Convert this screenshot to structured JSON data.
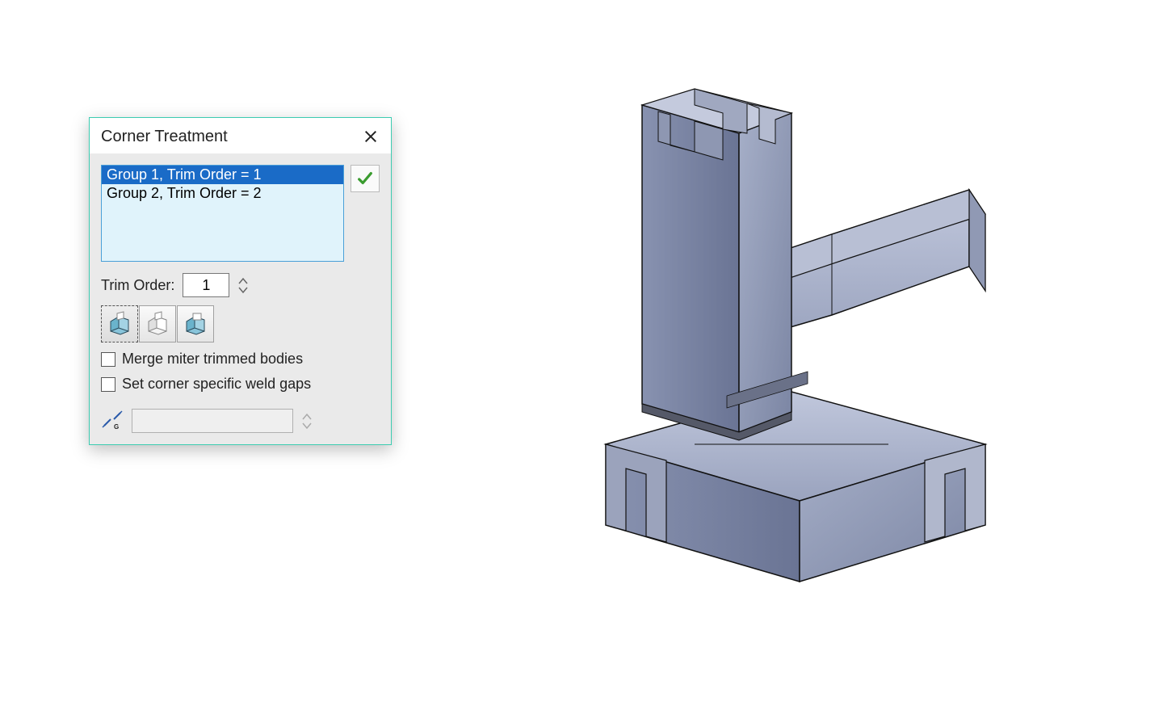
{
  "dialog": {
    "title": "Corner Treatment",
    "groups": [
      "Group 1, Trim Order = 1",
      "Group 2, Trim Order = 2"
    ],
    "selected_group_index": 0,
    "trim_order_label": "Trim Order:",
    "trim_order_value": "1",
    "checkboxes": {
      "merge_label": "Merge miter trimmed bodies",
      "merge_checked": false,
      "set_gaps_label": "Set corner specific weld gaps",
      "set_gaps_checked": false
    },
    "weld_gap_value": "",
    "corner_type_icons": [
      "trim-type-1-icon",
      "trim-type-2-icon",
      "trim-type-3-icon"
    ],
    "selected_corner_type_index": 0
  },
  "colors": {
    "accent": "#3cccb1",
    "selection": "#1a6bc7",
    "listbg": "#e0f3fb",
    "check_green": "#3a9c2f",
    "cube_fill": "#8894b8",
    "cube_stroke": "#1a1a1a"
  }
}
